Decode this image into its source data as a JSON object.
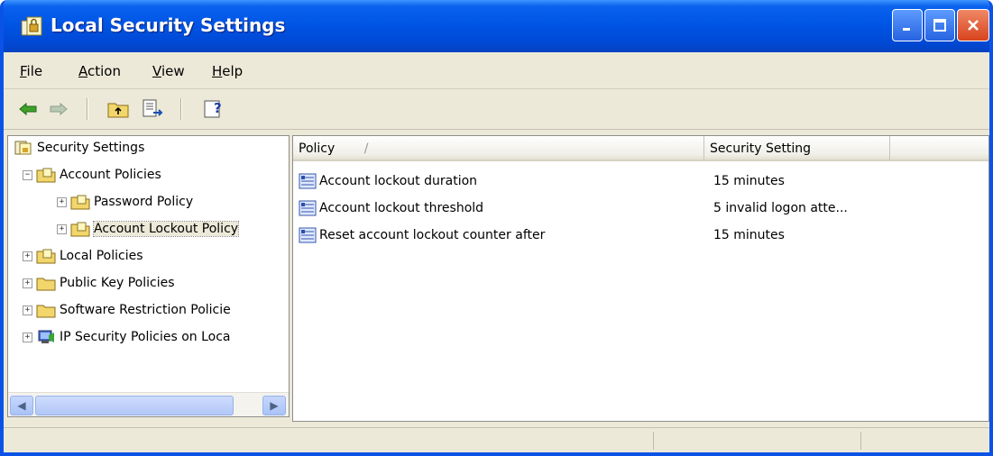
{
  "window": {
    "title": "Local Security Settings",
    "accent": "#0a53e6"
  },
  "menu": [
    {
      "pre": "",
      "acc": "F",
      "post": "ile"
    },
    {
      "pre": "",
      "acc": "A",
      "post": "ction"
    },
    {
      "pre": "",
      "acc": "V",
      "post": "iew"
    },
    {
      "pre": "",
      "acc": "H",
      "post": "elp"
    }
  ],
  "toolbar": {
    "icons": [
      "back-arrow-icon",
      "forward-arrow-icon",
      "up-folder-icon",
      "export-list-icon",
      "help-icon"
    ]
  },
  "tree": {
    "items": [
      {
        "label": "Security Settings",
        "icon": "security-settings-icon"
      },
      {
        "label": "Account Policies",
        "icon": "folder-policy-icon",
        "expander": "−"
      },
      {
        "label": "Password Policy",
        "icon": "folder-policy-icon",
        "expander": "+"
      },
      {
        "label": "Account Lockout Policy",
        "icon": "folder-policy-icon",
        "expander": "+"
      },
      {
        "label": "Local Policies",
        "icon": "folder-policy-icon",
        "expander": "+"
      },
      {
        "label": "Public Key Policies",
        "icon": "folder-icon",
        "expander": "+"
      },
      {
        "label": "Software Restriction Policie",
        "icon": "folder-icon",
        "expander": "+"
      },
      {
        "label": "IP Security Policies on Loca",
        "icon": "ip-security-icon",
        "expander": "+"
      }
    ]
  },
  "list": {
    "columns": [
      "Policy",
      "Security Setting"
    ],
    "sort_indicator": "/",
    "rows": [
      {
        "policy": "Account lockout duration",
        "setting": "15 minutes"
      },
      {
        "policy": "Account lockout threshold",
        "setting": "5 invalid logon atte..."
      },
      {
        "policy": "Reset account lockout counter after",
        "setting": "15 minutes"
      }
    ]
  }
}
